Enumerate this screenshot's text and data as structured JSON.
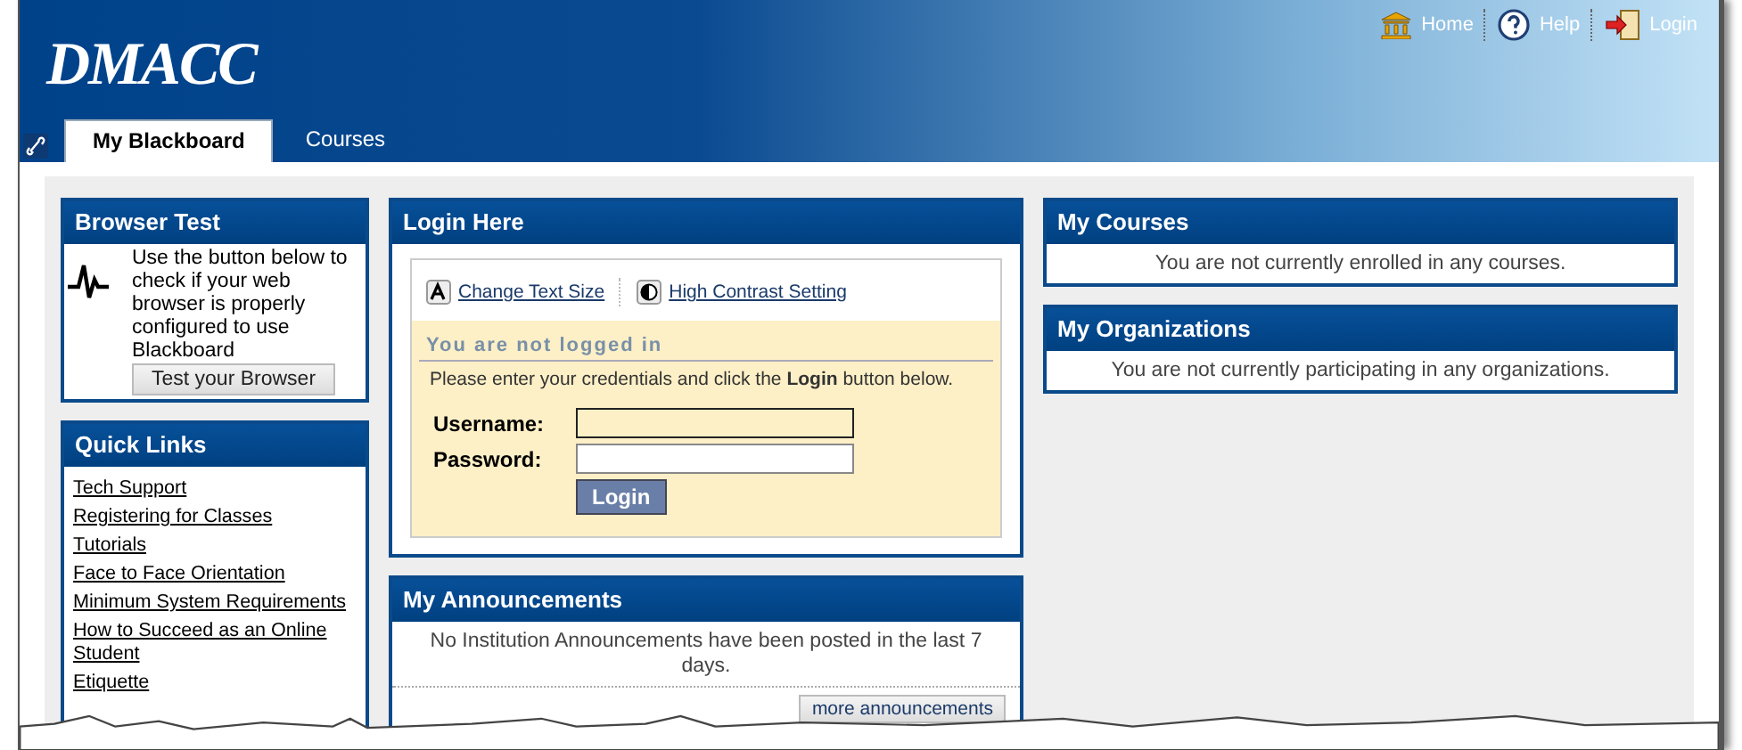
{
  "header": {
    "logo": "DMACC",
    "top_links": [
      {
        "kind": "home",
        "label": "Home"
      },
      {
        "kind": "help",
        "label": "Help"
      },
      {
        "kind": "login",
        "label": "Login"
      }
    ],
    "tabs": [
      {
        "label": "My Blackboard",
        "selected": true
      },
      {
        "label": "Courses",
        "selected": false
      }
    ]
  },
  "left_column": {
    "browser_test": {
      "title": "Browser Test",
      "text": "Use the button below to check if your web browser is properly configured to use Blackboard",
      "button": "Test your Browser"
    },
    "quick_links": {
      "title": "Quick Links",
      "links": [
        "Tech Support",
        "Registering for Classes",
        "Tutorials",
        "Face to Face Orientation",
        "Minimum System Requirements",
        "How to Succeed as an Online Student",
        "Etiquette"
      ]
    }
  },
  "middle_column": {
    "login": {
      "title": "Login Here",
      "tools": [
        {
          "kind": "text-size",
          "label": "Change Text Size"
        },
        {
          "kind": "contrast",
          "label": "High Contrast Setting"
        }
      ],
      "status": "You are not logged in",
      "instructions": "Please enter your credentials and click the **Login** button below.",
      "fields": [
        {
          "label": "Username:",
          "focused": true
        },
        {
          "label": "Password:",
          "focused": false
        }
      ],
      "button": "Login"
    },
    "announcements": {
      "title": "My Announcements",
      "message": "No Institution Announcements have been posted in the last 7 days.",
      "button": "more announcements"
    }
  },
  "right_column": {
    "panels": [
      {
        "title": "My Courses",
        "message": "You are not currently enrolled in any courses."
      },
      {
        "title": "My Organizations",
        "message": "You are not currently participating in any organizations."
      }
    ]
  }
}
